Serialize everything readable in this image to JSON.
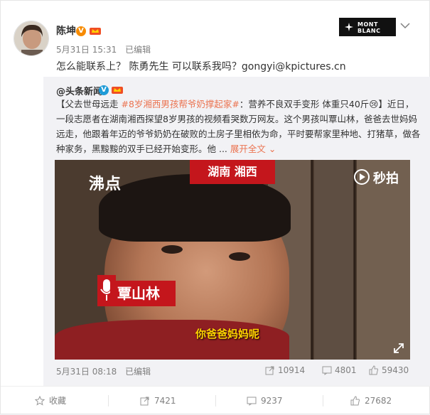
{
  "post": {
    "author": "陈坤",
    "date": "5月31日 15:31",
    "edited": "已编辑",
    "text": "怎么能联系上？  陈勇先生 可以联系我吗？gongyi@kpictures.cn",
    "brand_line1": "MONT",
    "brand_line2": "BLANC"
  },
  "repost": {
    "author": "@头条新闻",
    "text_prefix": "【父去世母远走 ",
    "hashtag": "#8岁湘西男孩帮爷奶撑起家#",
    "text_rest": "：营养不良双手变形 体重只40斤",
    "text_body": "】近日，一段志愿者在湖南湘西探望8岁男孩的视频看哭数万网友。这个男孩叫覃山林，爸爸去世妈妈远走，他跟着年迈的爷爷奶奶在破败的土房子里相依为命，平时要帮家里种地、打猪草，做各种家务，黑黢黢的双手已经开始变形。他 ... ",
    "more": "展开全文",
    "video": {
      "logo": "沸点",
      "location": "湖南 湘西",
      "platform": "秒拍",
      "name": "覃山林",
      "subtitle": "你爸爸妈妈呢"
    },
    "date": "5月31日 08:18",
    "edited": "已编辑",
    "reposts": "10914",
    "comments": "4801",
    "likes": "59430"
  },
  "actions": {
    "favorite": "收藏",
    "reposts": "7421",
    "comments": "9237",
    "likes": "27682"
  },
  "colors": {
    "link": "#eb7350",
    "red_tag": "#c4161c",
    "subtitle": "#ffd200"
  },
  "icons": [
    "vip-badge-icon",
    "chevron-down-icon",
    "play-icon",
    "repost-icon",
    "comment-icon",
    "like-icon",
    "favorite-icon",
    "expand-icon",
    "mic-icon"
  ]
}
